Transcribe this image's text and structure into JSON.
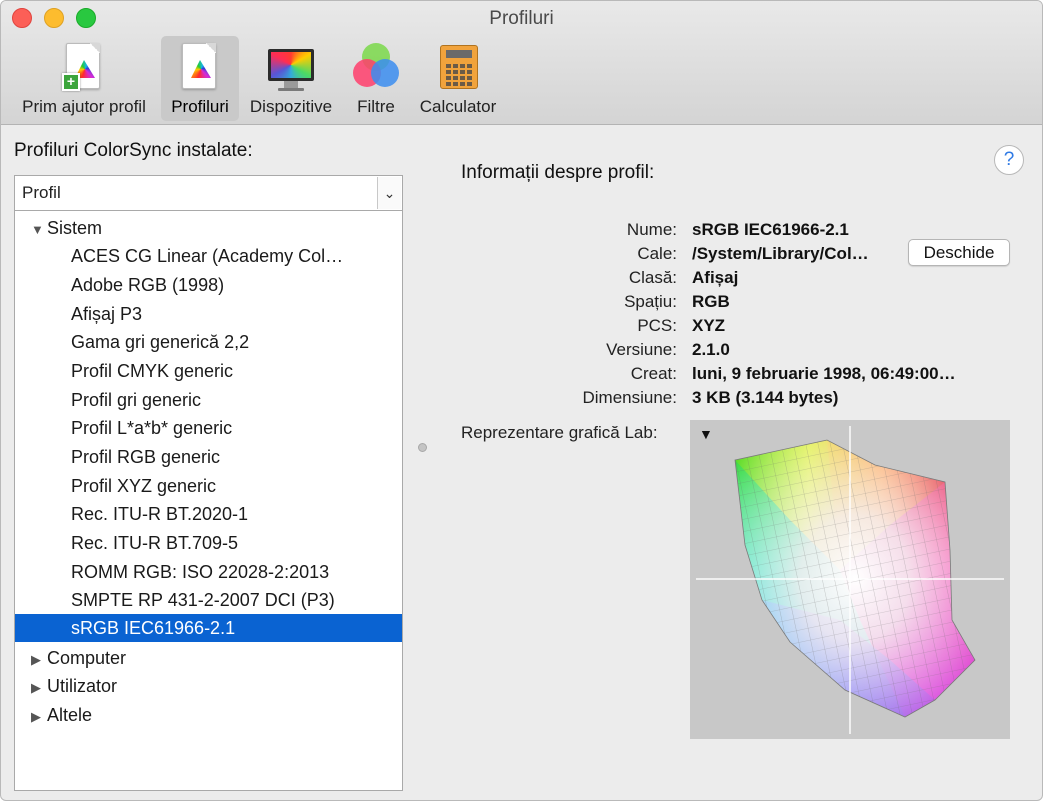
{
  "window": {
    "title": "Profiluri"
  },
  "toolbar": {
    "items": [
      {
        "label": "Prim ajutor profil",
        "icon": "profile-first-aid-icon"
      },
      {
        "label": "Profiluri",
        "icon": "profiles-icon",
        "selected": true
      },
      {
        "label": "Dispozitive",
        "icon": "devices-icon"
      },
      {
        "label": "Filtre",
        "icon": "filters-icon"
      },
      {
        "label": "Calculator",
        "icon": "calculator-icon"
      }
    ]
  },
  "left": {
    "heading": "Profiluri ColorSync instalate:",
    "dropdown_value": "Profil",
    "groups": [
      {
        "label": "Sistem",
        "expanded": true,
        "items": [
          "ACES CG Linear (Academy Col…",
          "Adobe RGB (1998)",
          "Afișaj P3",
          "Gama gri generică 2,2",
          "Profil CMYK generic",
          "Profil gri generic",
          "Profil L*a*b* generic",
          "Profil RGB generic",
          "Profil XYZ generic",
          "Rec. ITU-R BT.2020-1",
          "Rec. ITU-R BT.709-5",
          "ROMM RGB: ISO 22028-2:2013",
          "SMPTE RP 431-2-2007 DCI (P3)",
          "sRGB IEC61966-2.1"
        ],
        "selected_index": 13
      },
      {
        "label": "Computer",
        "expanded": false
      },
      {
        "label": "Utilizator",
        "expanded": false
      },
      {
        "label": "Altele",
        "expanded": false
      }
    ]
  },
  "info": {
    "heading": "Informații despre profil:",
    "help": "?",
    "open_button": "Deschide",
    "fields": [
      {
        "label": "Nume:",
        "value": "sRGB IEC61966-2.1"
      },
      {
        "label": "Cale:",
        "value": "/System/Library/Col…"
      },
      {
        "label": "Clasă:",
        "value": "Afișaj"
      },
      {
        "label": "Spațiu:",
        "value": "RGB"
      },
      {
        "label": "PCS:",
        "value": "XYZ"
      },
      {
        "label": "Versiune:",
        "value": "2.1.0"
      },
      {
        "label": "Creat:",
        "value": "luni, 9 februarie 1998, 06:49:00…"
      },
      {
        "label": "Dimensiune:",
        "value": "3 KB (3.144 bytes)"
      }
    ],
    "lab_label": "Reprezentare grafică Lab:"
  }
}
